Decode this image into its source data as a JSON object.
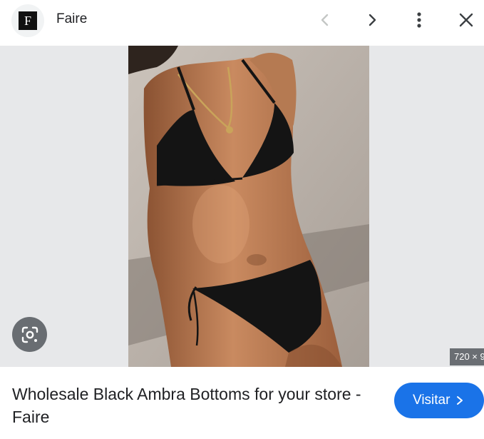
{
  "header": {
    "site_logo_letter": "F",
    "site_name": "Faire",
    "icons": [
      "chevron-left-icon",
      "chevron-right-icon",
      "more-vert-icon",
      "close-icon"
    ]
  },
  "viewer": {
    "image_dimensions": "720 × 9",
    "lens_icon": "lens-icon"
  },
  "result": {
    "title": "Wholesale Black Ambra Bottoms for your store - Faire",
    "visit_label": "Visitar",
    "visit_icon": "chevron-right-icon"
  },
  "colors": {
    "accent": "#1a73e8",
    "viewer_background": "#e7e8ea"
  }
}
